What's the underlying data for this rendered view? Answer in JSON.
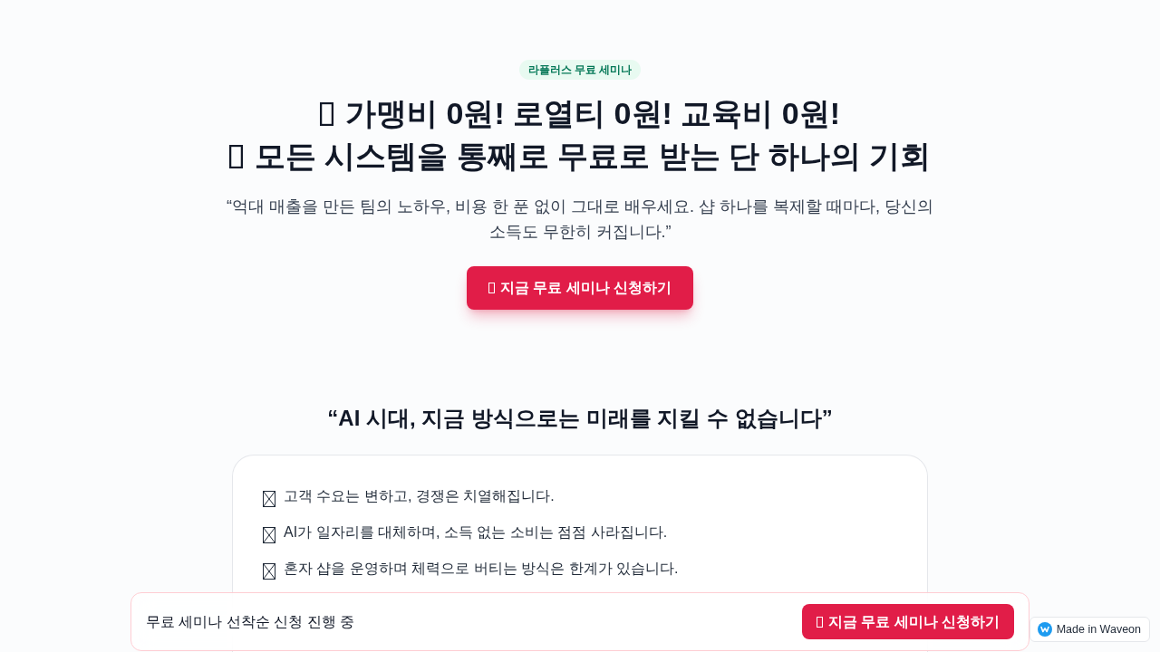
{
  "hero": {
    "badge": "라플러스 무료 세미나",
    "title_lines": [
      "가맹비 0원! 로열티 0원! 교육비 0원!",
      "모든 시스템을 통째로 무료로 받는 단 하나의 기회"
    ],
    "subtitle": "“억대 매출을 만든 팀의 노하우, 비용 한 푼 없이 그대로 배우세요. 샵 하나를 복제할 때마다, 당신의 소득도 무한히 커집니다.”",
    "cta_button": "지금 무료 세미나 신청하기"
  },
  "problem_section": {
    "heading": "“AI 시대, 지금 방식으로는 미래를 지킬 수 없습니다”",
    "points": [
      "고객 수요는 변하고, 경쟁은 치열해집니다.",
      "AI가 일자리를 대체하며, 소득 없는 소비는 점점 사라집니다.",
      "혼자 샵을 운영하며 체력으로 버티는 방식은 한계가 있습니다."
    ]
  },
  "sticky_bar": {
    "message": "무료 세미나 선착순 신청 진행 중",
    "cta_button": "지금 무료 세미나 신청하기"
  },
  "made_in_badge": {
    "label": "Made in Waveon"
  }
}
